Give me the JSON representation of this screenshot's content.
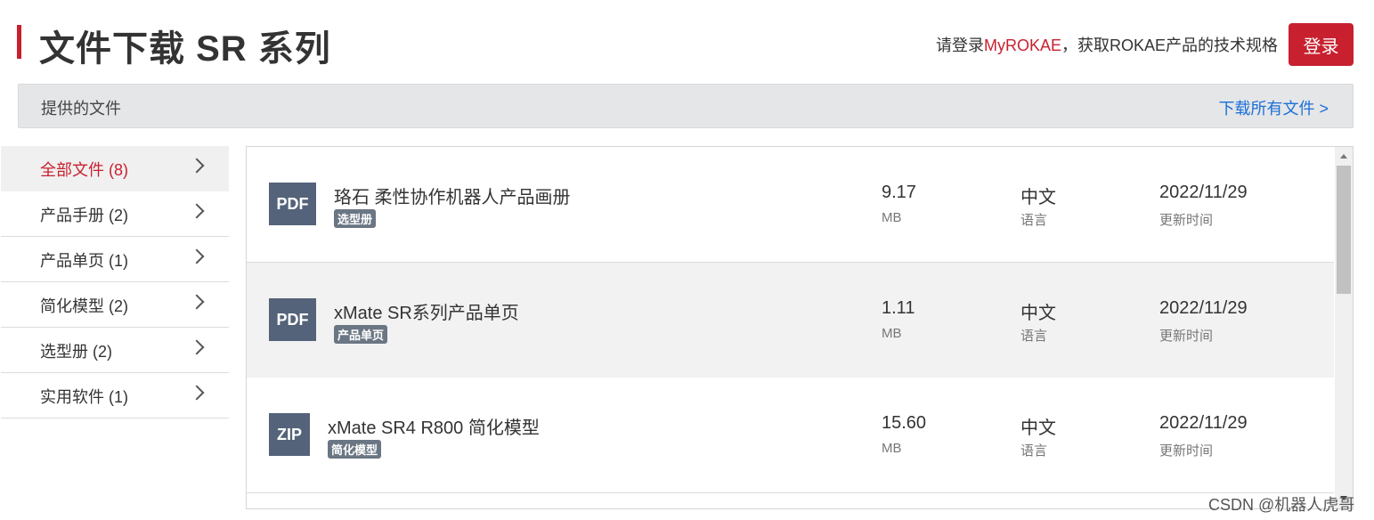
{
  "header": {
    "title": "文件下载 SR 系列",
    "login_hint_prefix": "请登录",
    "login_hint_brand": "MyROKAE",
    "login_hint_suffix": "，获取ROKAE产品的技术规格",
    "login_button": "登录"
  },
  "files_bar": {
    "title": "提供的文件",
    "download_all": "下载所有文件 >"
  },
  "sidebar": {
    "items": [
      {
        "label": "全部文件 (8)",
        "active": true
      },
      {
        "label": "产品手册 (2)",
        "active": false
      },
      {
        "label": "产品单页 (1)",
        "active": false
      },
      {
        "label": "简化模型 (2)",
        "active": false
      },
      {
        "label": "选型册 (2)",
        "active": false
      },
      {
        "label": "实用软件 (1)",
        "active": false
      }
    ]
  },
  "files": [
    {
      "type": "PDF",
      "name": "珞石  柔性协作机器人产品画册",
      "tag": "选型册",
      "size": "9.17",
      "size_unit": "MB",
      "lang": "中文",
      "lang_label": "语言",
      "date": "2022/11/29",
      "date_label": "更新时间"
    },
    {
      "type": "PDF",
      "name": "xMate SR系列产品单页",
      "tag": "产品单页",
      "size": "1.11",
      "size_unit": "MB",
      "lang": "中文",
      "lang_label": "语言",
      "date": "2022/11/29",
      "date_label": "更新时间"
    },
    {
      "type": "ZIP",
      "name": "xMate SR4 R800 简化模型",
      "tag": "简化模型",
      "size": "15.60",
      "size_unit": "MB",
      "lang": "中文",
      "lang_label": "语言",
      "date": "2022/11/29",
      "date_label": "更新时间"
    }
  ],
  "watermark": "CSDN @机器人虎哥",
  "colors": {
    "accent": "#c8202f",
    "link": "#1b6fd8",
    "file_icon": "#546379",
    "tag": "#6b7684"
  }
}
